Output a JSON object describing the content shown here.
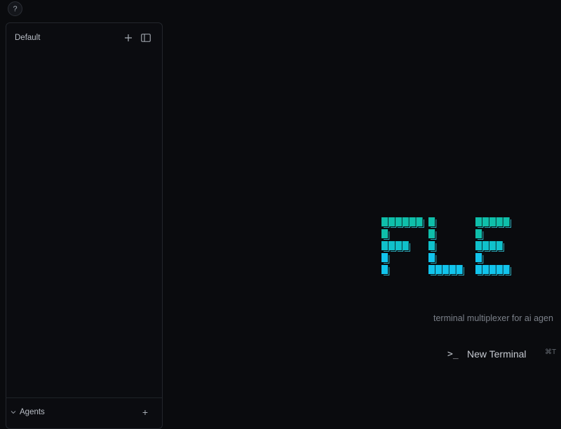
{
  "help": {
    "label": "?"
  },
  "sidebar": {
    "workspace_title": "Default",
    "add_icon": "plus-icon",
    "panel_icon": "sidebar-panel-icon",
    "agents": {
      "label": "Agents",
      "add_label": "+",
      "expanded": true
    }
  },
  "main": {
    "logo_text": "FLE",
    "tagline": "terminal multiplexer for ai agen",
    "new_terminal": {
      "icon": ">_",
      "label": "New Terminal",
      "shortcut": "⌘T"
    }
  },
  "colors": {
    "background": "#0a0b0e",
    "logo_top": "#0fbfaa",
    "logo_bottom": "#12c4ec",
    "logo_outline": "#35d4e6"
  }
}
